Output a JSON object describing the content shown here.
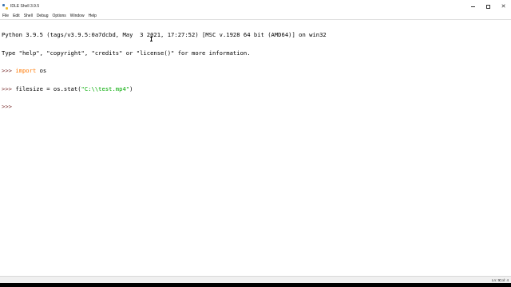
{
  "window": {
    "title": "IDLE Shell 3.9.5"
  },
  "menubar": {
    "items": [
      "File",
      "Edit",
      "Shell",
      "Debug",
      "Options",
      "Window",
      "Help"
    ]
  },
  "shell": {
    "banner_line1": "Python 3.9.5 (tags/v3.9.5:0a7dcbd, May  3 2021, 17:27:52) [MSC v.1928 64 bit (AMD64)] on win32",
    "banner_line2": "Type \"help\", \"copyright\", \"credits\" or \"license()\" for more information.",
    "prompt": ">>> ",
    "line3_keyword": "import",
    "line3_rest": " os",
    "line4_code_before": "filesize = os.stat(",
    "line4_string": "\"C:\\\\test.mp4\"",
    "line4_code_after": ")",
    "line5_prompt": ">>>"
  },
  "statusbar": {
    "ln": "Ln: 5",
    "col": "Col: 4"
  },
  "colors": {
    "keyword": "#ff7700",
    "string": "#00aa00",
    "prompt": "#7a2f2f"
  }
}
